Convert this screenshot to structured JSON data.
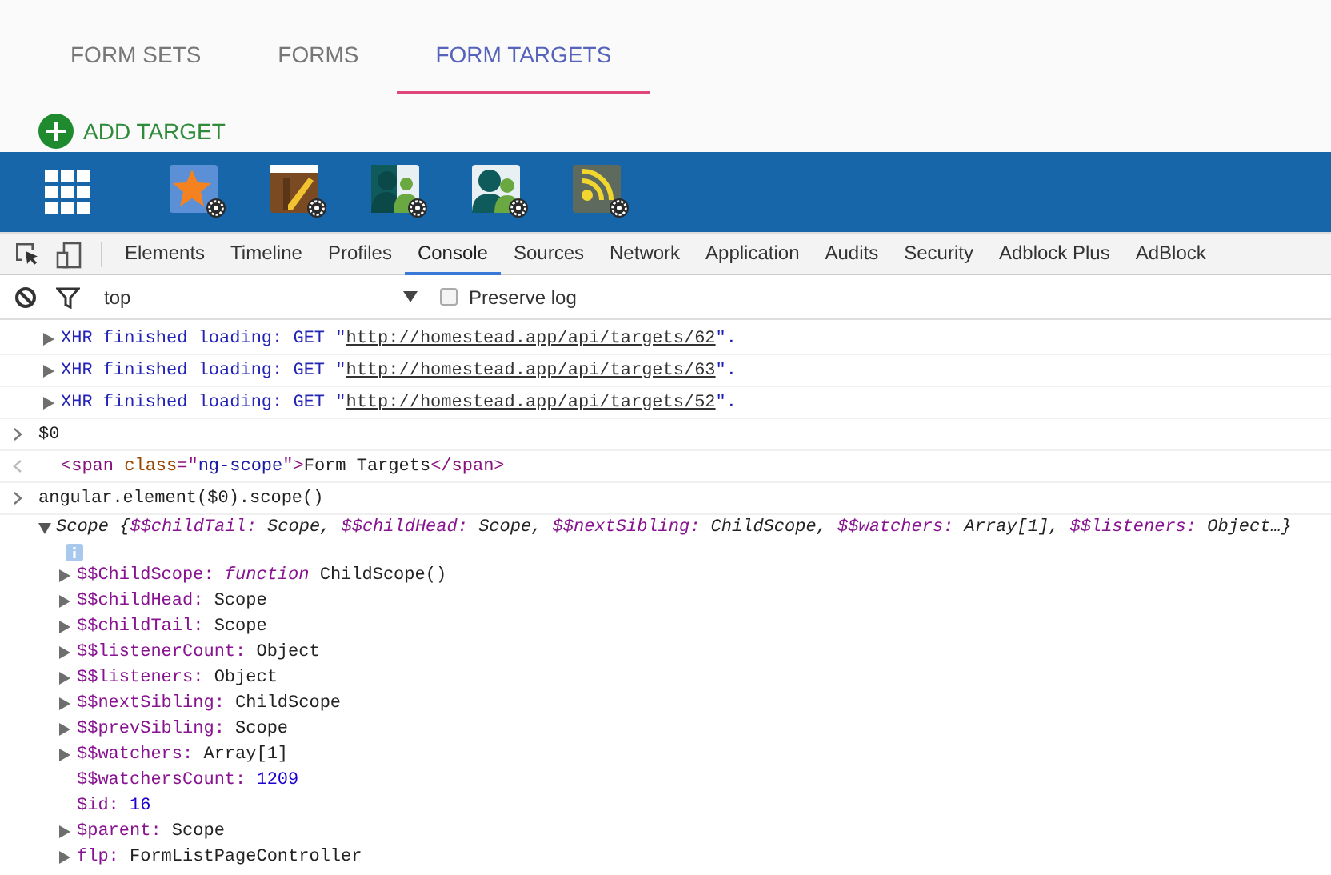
{
  "app_tabs": [
    {
      "label": "FORM SETS",
      "selected": false
    },
    {
      "label": "FORMS",
      "selected": false
    },
    {
      "label": "FORM TARGETS",
      "selected": true
    }
  ],
  "add_button": {
    "label": "ADD TARGET"
  },
  "devtools": {
    "tabs": [
      {
        "label": "Elements",
        "selected": false
      },
      {
        "label": "Timeline",
        "selected": false
      },
      {
        "label": "Profiles",
        "selected": false
      },
      {
        "label": "Console",
        "selected": true
      },
      {
        "label": "Sources",
        "selected": false
      },
      {
        "label": "Network",
        "selected": false
      },
      {
        "label": "Application",
        "selected": false
      },
      {
        "label": "Audits",
        "selected": false
      },
      {
        "label": "Security",
        "selected": false
      },
      {
        "label": "Adblock Plus",
        "selected": false
      },
      {
        "label": "AdBlock",
        "selected": false
      }
    ],
    "context": "top",
    "preserve_log": {
      "label": "Preserve log",
      "checked": false
    }
  },
  "console": {
    "entries": [
      {
        "kind": "log",
        "expanded": false,
        "segments": [
          {
            "kind": "xhr",
            "text": "XHR finished loading: GET \""
          },
          {
            "kind": "link",
            "text": "http://homestead.app/api/targets/62"
          },
          {
            "kind": "xhr",
            "text": "\"."
          }
        ]
      },
      {
        "kind": "log",
        "expanded": false,
        "segments": [
          {
            "kind": "xhr",
            "text": "XHR finished loading: GET \""
          },
          {
            "kind": "link",
            "text": "http://homestead.app/api/targets/63"
          },
          {
            "kind": "xhr",
            "text": "\"."
          }
        ]
      },
      {
        "kind": "log",
        "expanded": false,
        "segments": [
          {
            "kind": "xhr",
            "text": "XHR finished loading: GET \""
          },
          {
            "kind": "link",
            "text": "http://homestead.app/api/targets/52"
          },
          {
            "kind": "xhr",
            "text": "\"."
          }
        ]
      },
      {
        "kind": "input",
        "segments": [
          {
            "kind": "plain",
            "text": "$0"
          }
        ]
      },
      {
        "kind": "output",
        "segments": [
          {
            "kind": "tag",
            "text": "<span"
          },
          {
            "kind": "attr",
            "text": " class"
          },
          {
            "kind": "tag",
            "text": "=\""
          },
          {
            "kind": "value",
            "text": "ng-scope"
          },
          {
            "kind": "tag",
            "text": "\">"
          },
          {
            "kind": "plain",
            "text": "Form Targets"
          },
          {
            "kind": "tag",
            "text": "</span>"
          }
        ]
      },
      {
        "kind": "input",
        "segments": [
          {
            "kind": "plain",
            "text": "angular.element($0).scope()"
          }
        ]
      },
      {
        "kind": "object",
        "expanded": true,
        "segments": [
          {
            "kind": "plain",
            "text": "Scope {"
          },
          {
            "kind": "key",
            "text": "$$childTail:"
          },
          {
            "kind": "plain",
            "text": " Scope, "
          },
          {
            "kind": "key",
            "text": "$$childHead:"
          },
          {
            "kind": "plain",
            "text": " Scope, "
          },
          {
            "kind": "key",
            "text": "$$nextSibling:"
          },
          {
            "kind": "plain",
            "text": " ChildScope, "
          },
          {
            "kind": "key",
            "text": "$$watchers:"
          },
          {
            "kind": "plain",
            "text": " Array[1], "
          },
          {
            "kind": "key",
            "text": "$$listeners:"
          },
          {
            "kind": "plain",
            "text": " Object…}"
          }
        ],
        "children": [
          {
            "kind": "node",
            "expanded": false,
            "segments": [
              {
                "kind": "key",
                "text": "$$ChildScope:"
              },
              {
                "kind": "func",
                "text": " function"
              },
              {
                "kind": "plain",
                "text": " ChildScope()"
              }
            ]
          },
          {
            "kind": "node",
            "expanded": false,
            "segments": [
              {
                "kind": "key",
                "text": "$$childHead:"
              },
              {
                "kind": "plain",
                "text": " Scope"
              }
            ]
          },
          {
            "kind": "node",
            "expanded": false,
            "segments": [
              {
                "kind": "key",
                "text": "$$childTail:"
              },
              {
                "kind": "plain",
                "text": " Scope"
              }
            ]
          },
          {
            "kind": "node",
            "expanded": false,
            "segments": [
              {
                "kind": "key",
                "text": "$$listenerCount:"
              },
              {
                "kind": "plain",
                "text": " Object"
              }
            ]
          },
          {
            "kind": "node",
            "expanded": false,
            "segments": [
              {
                "kind": "key",
                "text": "$$listeners:"
              },
              {
                "kind": "plain",
                "text": " Object"
              }
            ]
          },
          {
            "kind": "node",
            "expanded": false,
            "segments": [
              {
                "kind": "key",
                "text": "$$nextSibling:"
              },
              {
                "kind": "plain",
                "text": " ChildScope"
              }
            ]
          },
          {
            "kind": "node",
            "expanded": false,
            "segments": [
              {
                "kind": "key",
                "text": "$$prevSibling:"
              },
              {
                "kind": "plain",
                "text": " Scope"
              }
            ]
          },
          {
            "kind": "node",
            "expanded": false,
            "segments": [
              {
                "kind": "key",
                "text": "$$watchers:"
              },
              {
                "kind": "plain",
                "text": " Array[1]"
              }
            ]
          },
          {
            "kind": "leaf",
            "segments": [
              {
                "kind": "key",
                "text": "$$watchersCount:"
              },
              {
                "kind": "number",
                "text": " 1209"
              }
            ]
          },
          {
            "kind": "leaf",
            "segments": [
              {
                "kind": "key",
                "text": "$id:"
              },
              {
                "kind": "number",
                "text": " 16"
              }
            ]
          },
          {
            "kind": "node",
            "expanded": false,
            "segments": [
              {
                "kind": "key",
                "text": "$parent:"
              },
              {
                "kind": "plain",
                "text": " Scope"
              }
            ]
          },
          {
            "kind": "node",
            "expanded": false,
            "segments": [
              {
                "kind": "key",
                "text": "flp:"
              },
              {
                "kind": "plain",
                "text": " FormListPageController"
              }
            ]
          }
        ]
      }
    ]
  }
}
